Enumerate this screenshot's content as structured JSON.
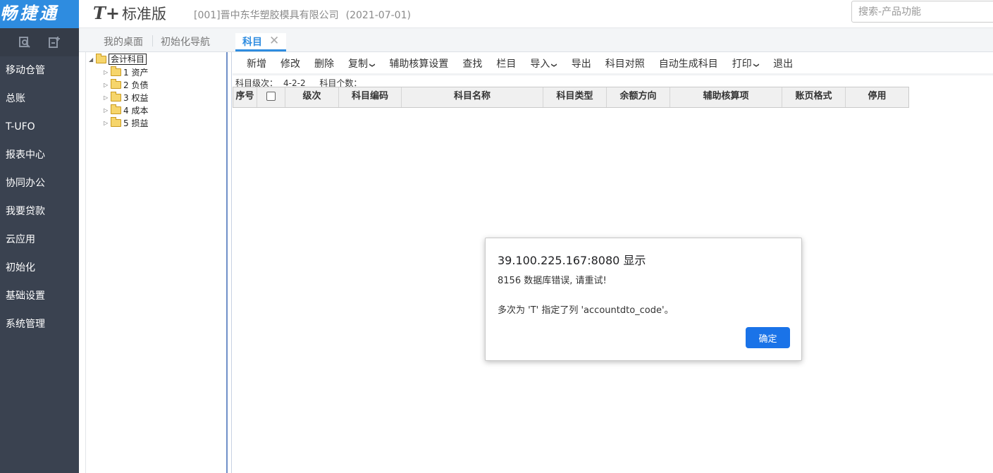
{
  "sidebar": {
    "logo": "畅捷通",
    "tools": [
      {
        "icon": "search-doc-icon"
      },
      {
        "icon": "add-doc-icon"
      }
    ],
    "items": [
      {
        "label": "移动仓管"
      },
      {
        "label": "总账"
      },
      {
        "label": "T-UFO"
      },
      {
        "label": "报表中心"
      },
      {
        "label": "协同办公"
      },
      {
        "label": "我要贷款"
      },
      {
        "label": "云应用"
      },
      {
        "label": "初始化"
      },
      {
        "label": "基础设置"
      },
      {
        "label": "系统管理"
      }
    ]
  },
  "header": {
    "brand_t": "T+",
    "brand_name": "标准版",
    "company": "[001]晋中东华塑胶模具有限公司",
    "date": "(2021-07-01)",
    "search_placeholder": "搜索-产品功能"
  },
  "tabs": {
    "desktop": "我的桌面",
    "init_nav": "初始化导航",
    "active": "科目",
    "close_glyph": "✕"
  },
  "tree": {
    "root": "会计科目",
    "children": [
      {
        "label": "1 资产"
      },
      {
        "label": "2 负债"
      },
      {
        "label": "3 权益"
      },
      {
        "label": "4 成本"
      },
      {
        "label": "5 损益"
      }
    ]
  },
  "toolbar": {
    "buttons": [
      {
        "label": "新增"
      },
      {
        "label": "修改"
      },
      {
        "label": "删除"
      },
      {
        "label": "复制",
        "has_menu": true
      },
      {
        "label": "辅助核算设置"
      },
      {
        "label": "查找"
      },
      {
        "label": "栏目"
      },
      {
        "label": "导入",
        "has_menu": true
      },
      {
        "label": "导出"
      },
      {
        "label": "科目对照"
      },
      {
        "label": "自动生成科目"
      },
      {
        "label": "打印",
        "has_menu": true
      },
      {
        "label": "退出"
      }
    ]
  },
  "info": {
    "level_label": "科目级次：",
    "level_value": "4-2-2",
    "count_label": "科目个数："
  },
  "grid": {
    "columns": [
      {
        "label": "序号"
      },
      {
        "label": ""
      },
      {
        "label": "级次"
      },
      {
        "label": "科目编码"
      },
      {
        "label": "科目名称"
      },
      {
        "label": "科目类型"
      },
      {
        "label": "余额方向"
      },
      {
        "label": "辅助核算项"
      },
      {
        "label": "账页格式"
      },
      {
        "label": "停用"
      }
    ],
    "rows": []
  },
  "dialog": {
    "title": "39.100.225.167:8080 显示",
    "message_1": "8156 数据库错误, 请重试!",
    "message_2": "多次为 'T' 指定了列 'accountdto_code'。",
    "ok_label": "确定"
  },
  "colors": {
    "sidebar_bg": "#3a4250",
    "logo_bg": "#2e8ce0",
    "accent": "#2e8ce0",
    "dialog_button": "#1a73e8"
  }
}
